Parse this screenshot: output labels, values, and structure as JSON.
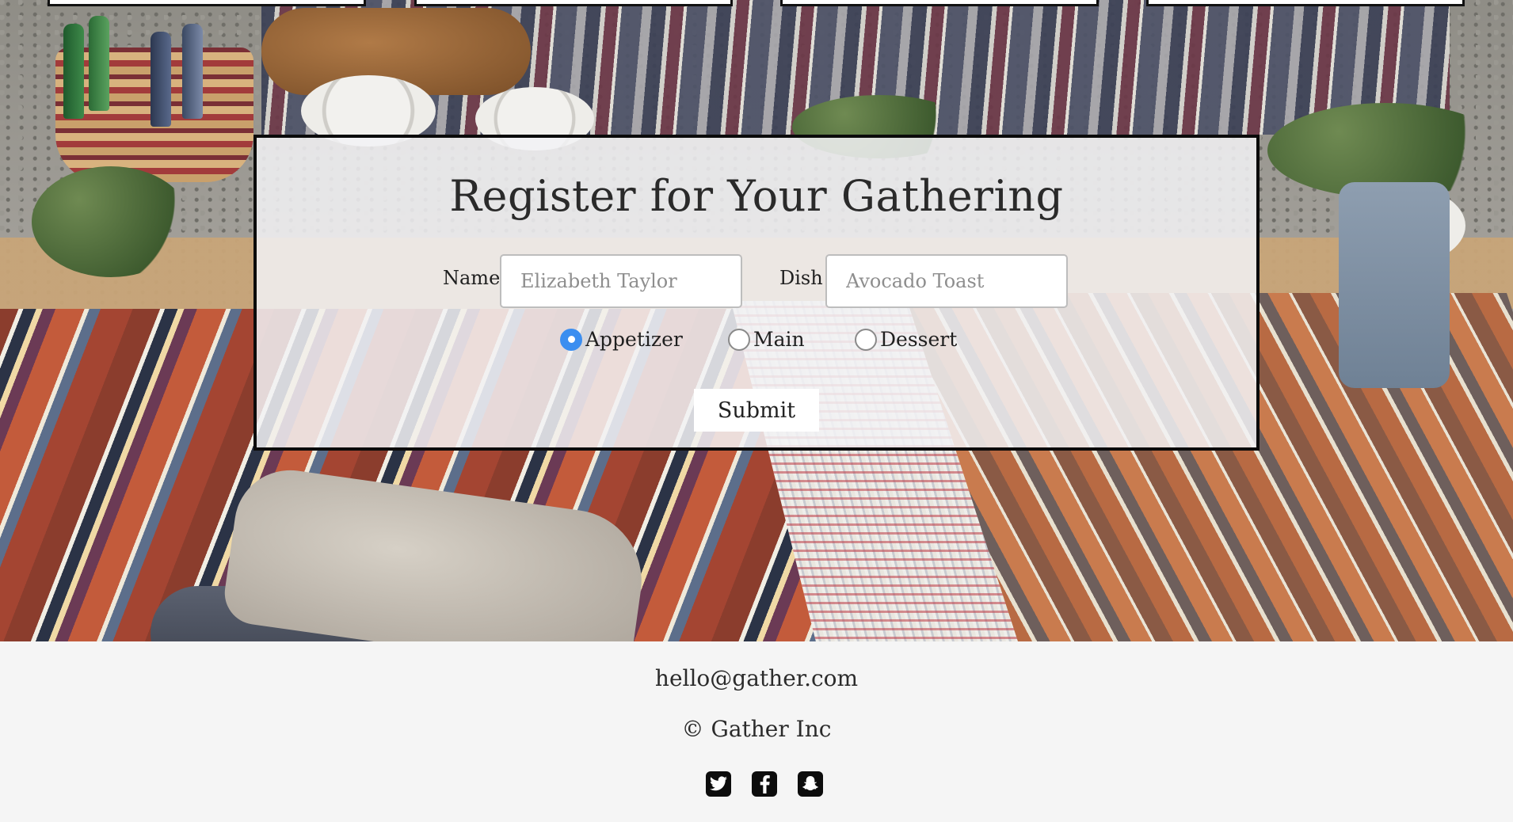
{
  "nav": {
    "boxes": [
      "",
      "",
      "",
      ""
    ]
  },
  "form": {
    "title": "Register for Your Gathering",
    "name_label": "Name",
    "name_placeholder": "Elizabeth Taylor",
    "dish_label": "Dish",
    "dish_placeholder": "Avocado Toast",
    "courses": [
      {
        "label": "Appetizer",
        "checked": true
      },
      {
        "label": "Main",
        "checked": false
      },
      {
        "label": "Dessert",
        "checked": false
      }
    ],
    "submit_label": "Submit",
    "accent_color": "#3b8ef0"
  },
  "footer": {
    "email": "hello@gather.com",
    "copyright": "© Gather Inc",
    "social": [
      {
        "icon": "twitter-icon"
      },
      {
        "icon": "facebook-icon"
      },
      {
        "icon": "snapchat-icon"
      }
    ]
  }
}
